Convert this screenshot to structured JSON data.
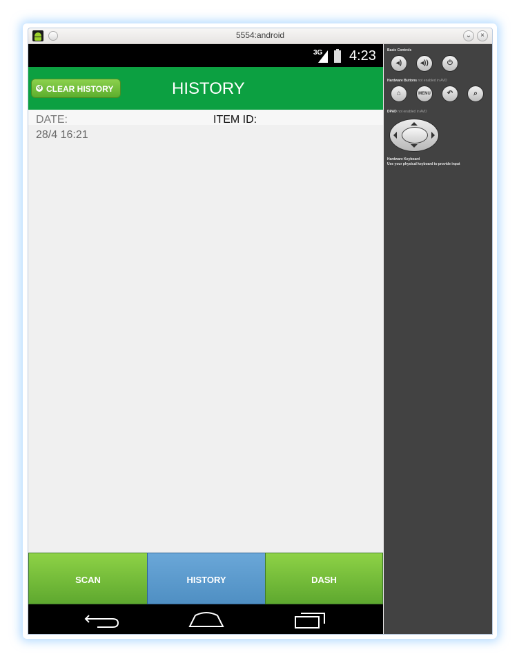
{
  "window": {
    "title": "5554:android",
    "icon": "android-icon",
    "controls": [
      "minimize-icon",
      "close-icon"
    ]
  },
  "statusbar": {
    "network": "3G",
    "time": "4:23",
    "icons": [
      "signal-icon",
      "battery-icon"
    ]
  },
  "actionbar": {
    "clear_label": "CLEAR HISTORY",
    "title": "HISTORY",
    "color": "#0ca041"
  },
  "list": {
    "date_header": "DATE:",
    "item_header": "ITEM ID:",
    "rows": [
      {
        "date": "28/4 16:21"
      }
    ]
  },
  "bottom_nav": {
    "tabs": [
      {
        "label": "SCAN",
        "active": false
      },
      {
        "label": "HISTORY",
        "active": true
      },
      {
        "label": "DASH",
        "active": false
      }
    ],
    "active_color": "#5a9ad0",
    "inactive_color": "#7cc63f"
  },
  "navbar": {
    "icons": [
      "back-icon",
      "home-icon",
      "recent-apps-icon"
    ]
  },
  "controls_panel": {
    "basic_controls": "Basic Controls",
    "hardware_buttons": "Hardware Buttons",
    "hardware_buttons_note": "not enabled in AVD",
    "dpad": "DPAD",
    "dpad_note": "not enabled in AVD",
    "keyboard_title": "Hardware Keyboard",
    "keyboard_note": "Use your physical keyboard to provide input",
    "menu_label": "MENU",
    "basic_icons": [
      "volume-down-icon",
      "volume-up-icon",
      "power-icon"
    ],
    "hardware_icons": [
      "home-icon",
      "menu-icon",
      "back-icon",
      "search-icon"
    ]
  }
}
